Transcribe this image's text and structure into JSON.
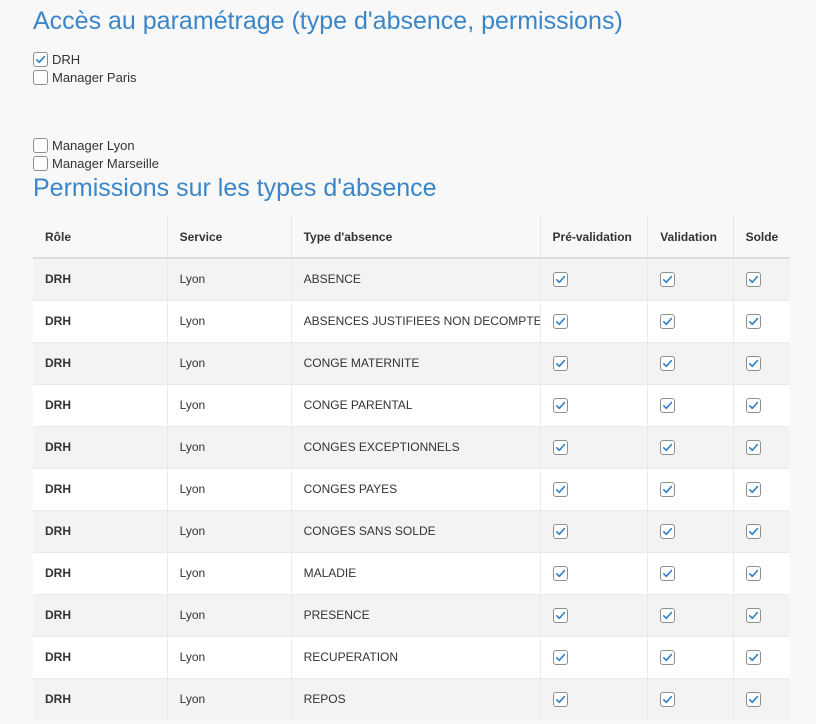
{
  "section_access": {
    "title": "Accès au paramétrage (type d'absence, permissions)",
    "roles": [
      {
        "label": "DRH",
        "checked": true
      },
      {
        "label": "Manager Paris",
        "checked": false
      },
      {
        "label": "Manager Lyon",
        "checked": false
      },
      {
        "label": "Manager Marseille",
        "checked": false
      }
    ]
  },
  "section_permissions": {
    "title": "Permissions sur les types d'absence",
    "headers": {
      "role": "Rôle",
      "service": "Service",
      "type": "Type d'absence",
      "prevalidation": "Pré-validation",
      "validation": "Validation",
      "solde": "Solde"
    },
    "rows": [
      {
        "role": "DRH",
        "service": "Lyon",
        "type": "ABSENCE",
        "prevalidation": true,
        "validation": true,
        "solde": true
      },
      {
        "role": "DRH",
        "service": "Lyon",
        "type": "ABSENCES JUSTIFIEES NON DECOMPTEES",
        "prevalidation": true,
        "validation": true,
        "solde": true
      },
      {
        "role": "DRH",
        "service": "Lyon",
        "type": "CONGE MATERNITE",
        "prevalidation": true,
        "validation": true,
        "solde": true
      },
      {
        "role": "DRH",
        "service": "Lyon",
        "type": "CONGE PARENTAL",
        "prevalidation": true,
        "validation": true,
        "solde": true
      },
      {
        "role": "DRH",
        "service": "Lyon",
        "type": "CONGES EXCEPTIONNELS",
        "prevalidation": true,
        "validation": true,
        "solde": true
      },
      {
        "role": "DRH",
        "service": "Lyon",
        "type": "CONGES PAYES",
        "prevalidation": true,
        "validation": true,
        "solde": true
      },
      {
        "role": "DRH",
        "service": "Lyon",
        "type": "CONGES SANS SOLDE",
        "prevalidation": true,
        "validation": true,
        "solde": true
      },
      {
        "role": "DRH",
        "service": "Lyon",
        "type": "MALADIE",
        "prevalidation": true,
        "validation": true,
        "solde": true
      },
      {
        "role": "DRH",
        "service": "Lyon",
        "type": "PRESENCE",
        "prevalidation": true,
        "validation": true,
        "solde": true
      },
      {
        "role": "DRH",
        "service": "Lyon",
        "type": "RECUPERATION",
        "prevalidation": true,
        "validation": true,
        "solde": true
      },
      {
        "role": "DRH",
        "service": "Lyon",
        "type": "REPOS",
        "prevalidation": true,
        "validation": true,
        "solde": true
      }
    ]
  },
  "colors": {
    "title": "#3a86c8",
    "check": "#2f7fc6"
  }
}
